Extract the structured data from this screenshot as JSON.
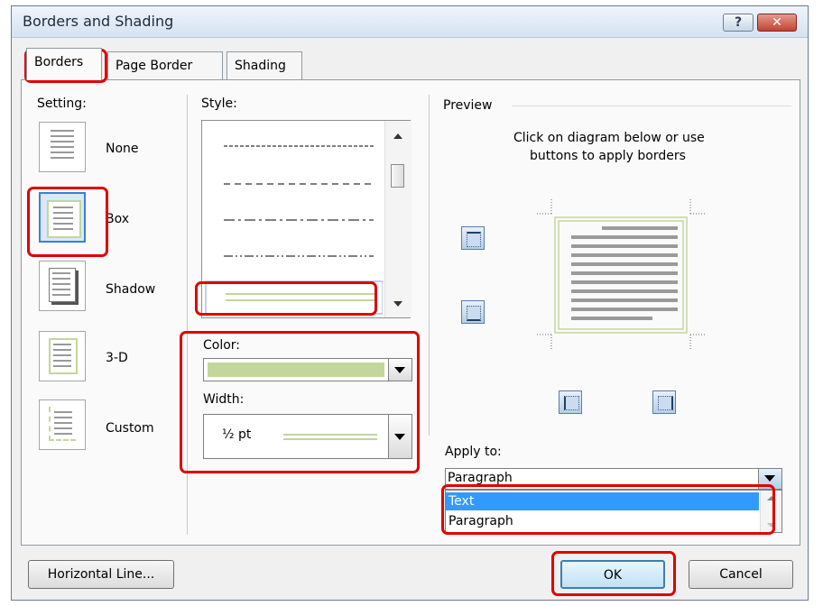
{
  "window": {
    "title": "Borders and Shading",
    "help_glyph": "?",
    "close_glyph": "✕"
  },
  "tabs": [
    {
      "label": "Borders",
      "active": true
    },
    {
      "label": "Page Border",
      "active": false
    },
    {
      "label": "Shading",
      "active": false
    }
  ],
  "setting": {
    "label": "Setting:",
    "items": [
      {
        "label": "None",
        "icon": "none-setting-icon"
      },
      {
        "label": "Box",
        "icon": "box-setting-icon",
        "selected": true
      },
      {
        "label": "Shadow",
        "icon": "shadow-setting-icon"
      },
      {
        "label": "3-D",
        "icon": "3d-setting-icon"
      },
      {
        "label": "Custom",
        "icon": "custom-setting-icon"
      }
    ]
  },
  "style": {
    "label": "Style:",
    "selected_style": "double line"
  },
  "color": {
    "label": "Color:",
    "value_hex": "#c3d69b"
  },
  "width": {
    "label": "Width:",
    "value": "½ pt"
  },
  "preview": {
    "label": "Preview",
    "instruction_line1": "Click on diagram below or use",
    "instruction_line2": "buttons to apply borders"
  },
  "apply_to": {
    "label": "Apply to:",
    "value": "Paragraph",
    "options": [
      "Text",
      "Paragraph"
    ],
    "highlighted": "Text"
  },
  "buttons": {
    "horizontal_line": "Horizontal Line...",
    "ok": "OK",
    "cancel": "Cancel"
  },
  "colors": {
    "accent_green": "#c3d69b",
    "highlight_red": "#e00000",
    "selection_blue": "#3399ff"
  }
}
